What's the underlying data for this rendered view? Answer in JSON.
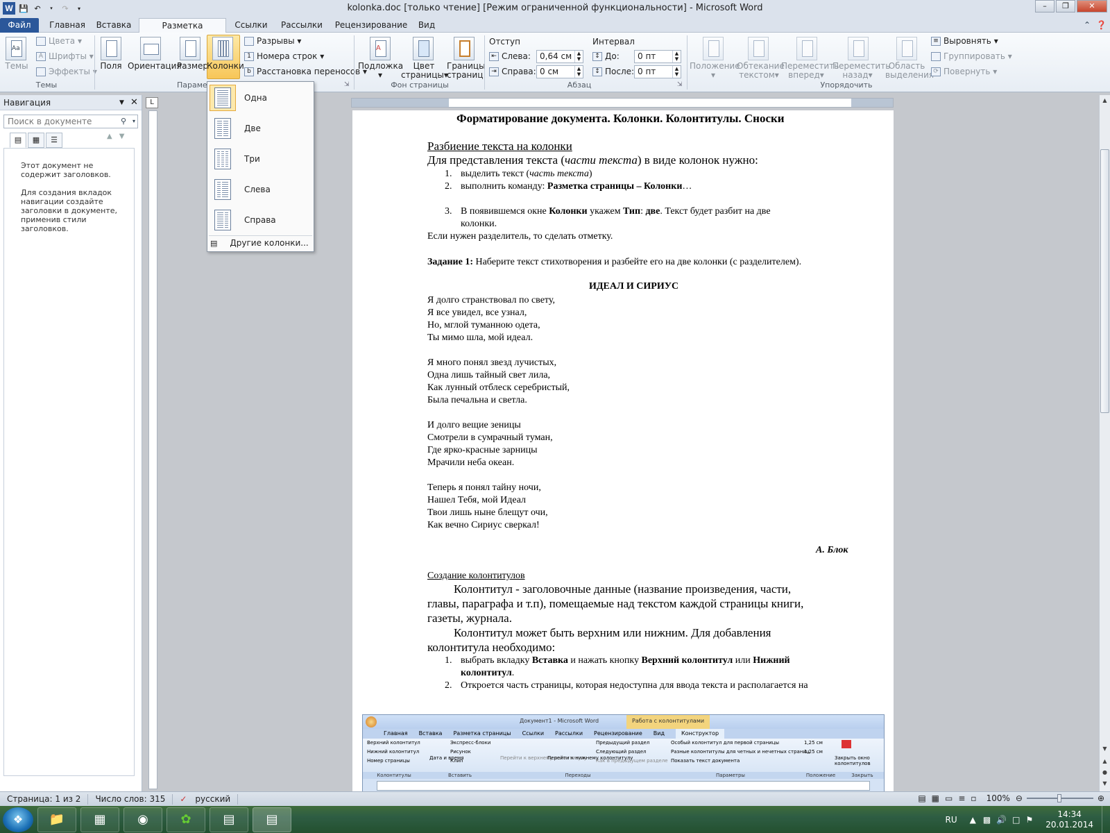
{
  "window": {
    "title": "kolonka.doc [только чтение] [Режим ограниченной функциональности]  -  Microsoft Word",
    "logo": "W"
  },
  "tabs": [
    "Файл",
    "Главная",
    "Вставка",
    "Разметка страницы",
    "Ссылки",
    "Рассылки",
    "Рецензирование",
    "Вид"
  ],
  "active_tab": "Разметка страницы",
  "ribbon": {
    "themes": {
      "big": "Темы",
      "colors": "Цвета",
      "fonts": "Шрифты",
      "effects": "Эффекты",
      "group": "Темы"
    },
    "page_setup": {
      "fields": "Поля",
      "orientation": "Ориентация",
      "size": "Размер",
      "columns": "Колонки",
      "breaks": "Разрывы",
      "line_numbers": "Номера строк",
      "hyphenation": "Расстановка переносов",
      "group": "Парамет"
    },
    "background": {
      "watermark": "Подложка",
      "page_color_1": "Цвет",
      "page_color_2": "страницы",
      "borders_1": "Границы",
      "borders_2": "страниц",
      "group": "Фон страницы"
    },
    "paragraph": {
      "indent": "Отступ",
      "left": "Слева:",
      "left_val": "0,64 см",
      "right": "Справа:",
      "right_val": "0 см",
      "spacing": "Интервал",
      "before": "До:",
      "before_val": "0 пт",
      "after": "После:",
      "after_val": "0 пт",
      "group": "Абзац"
    },
    "arrange": {
      "position": "Положение",
      "wrap_1": "Обтекание",
      "wrap_2": "текстом",
      "forward_1": "Переместить",
      "forward_2": "вперед",
      "back_1": "Переместить",
      "back_2": "назад",
      "selection_1": "Область",
      "selection_2": "выделения",
      "align": "Выровнять",
      "group_btn": "Группировать",
      "rotate": "Повернуть",
      "group": "Упорядочить"
    }
  },
  "columns_menu": {
    "items": [
      "Одна",
      "Две",
      "Три",
      "Слева",
      "Справа"
    ],
    "more": "Другие колонки..."
  },
  "navigation": {
    "title": "Навигация",
    "search_placeholder": "Поиск в документе",
    "msg1": "Этот документ не содержит заголовков.",
    "msg2": "Для создания вкладок навигации создайте заголовки в документе, применив стили заголовков."
  },
  "document": {
    "title": "Форматирование документа. Колонки. Колонтитулы. Сноски",
    "h_columns": "Разбиение текста на колонки",
    "intro_a": "Для представления текста (",
    "intro_b": "части текста",
    "intro_c": ") в виде колонок нужно:",
    "step1_num": "1.",
    "step1_a": "выделить текст (",
    "step1_b": "часть текста",
    "step1_c": ")",
    "step2_num": "2.",
    "step2_a": "выполнить команду: ",
    "step2_b": "Разметка страницы – Колонки",
    "step2_c": "…",
    "step3_num": "3.",
    "step3_a": "В появившемся окне ",
    "step3_b": "Колонки",
    "step3_c": " укажем ",
    "step3_d": "Тип",
    "step3_e": ": ",
    "step3_f": "две",
    "step3_g": ". Текст будет разбит на две",
    "step3_line2": "колонки.",
    "separator": "Если нужен разделитель, то сделать отметку.",
    "task_a": "Задание 1:",
    "task_b": " Наберите текст стихотворения и разбейте его на две колонки (с разделителем).",
    "poem_title": "ИДЕАЛ И СИРИУС",
    "poem": [
      "Я долго странствовал по свету,",
      "Я все увидел, все узнал,",
      "Но, мглой туманною одета,",
      "Ты мимо шла, мой идеал.",
      "",
      "Я много понял звезд лучистых,",
      "Одна лишь тайный свет лила,",
      "Как лунный отблеск серебристый,",
      "Была печальна и светла.",
      "",
      "И долго вещие зеницы",
      "Смотрели в сумрачный туман,",
      "Где ярко-красные зарницы",
      "Мрачили неба океан.",
      "",
      "Теперь я понял тайну ночи,",
      "Нашел Тебя, мой Идеал",
      "Твои лишь ныне блещут очи,",
      "Как вечно Сириус сверкал!"
    ],
    "author": "А. Блок",
    "h_headers": "Создание колонтитулов",
    "hf1": "Колонтитул - заголовочные данные (название произведения, части,",
    "hf2": "главы, параграфа и т.п), помещаемые над текстом каждой страницы книги,",
    "hf3": "газеты, журнала.",
    "hf4": "Колонтитул может быть верхним или нижним. Для добавления",
    "hf5": "колонтитула необходимо:",
    "hs1_num": "1.",
    "hs1_a": "выбрать вкладку ",
    "hs1_b": "Вставка",
    "hs1_c": " и нажать кнопку ",
    "hs1_d": "Верхний колонтитул",
    "hs1_e": " или ",
    "hs1_f": "Нижний",
    "hs1_line2_a": "колонтитул",
    "hs1_line2_b": ".",
    "hs2_num": "2.",
    "hs2": "Откроется часть страницы, которая недоступна для ввода текста и располагается на"
  },
  "embedded": {
    "title": "Документ1 - Microsoft Word",
    "context": "Работа с колонтитулами",
    "tabs": [
      "Главная",
      "Вставка",
      "Разметка страницы",
      "Ссылки",
      "Рассылки",
      "Рецензирование",
      "Вид"
    ],
    "active": "Конструктор",
    "items": [
      "Верхний колонтитул",
      "Нижний колонтитул",
      "Номер страницы",
      "Дата и время",
      "Экспресс-блоки",
      "Рисунок",
      "Клип",
      "Перейти к верхнему колонтитулу",
      "Перейти к нижнему колонтитулу",
      "Предыдущий раздел",
      "Следующий раздел",
      "Как в предыдущем разделе",
      "Особый колонтитул для первой страницы",
      "Разные колонтитулы для четных и нечетных страниц",
      "Показать текст документа",
      "1,25 см",
      "1,25 см",
      "Закрыть окно колонтитулов"
    ],
    "groups": [
      "Колонтитулы",
      "Вставить",
      "Переходы",
      "Параметры",
      "Положение",
      "Закрыть"
    ]
  },
  "status": {
    "page": "Страница: 1 из 2",
    "words": "Число слов: 315",
    "lang": "русский",
    "zoom": "100%"
  },
  "tray": {
    "lang": "RU",
    "time": "14:34",
    "date": "20.01.2014"
  }
}
